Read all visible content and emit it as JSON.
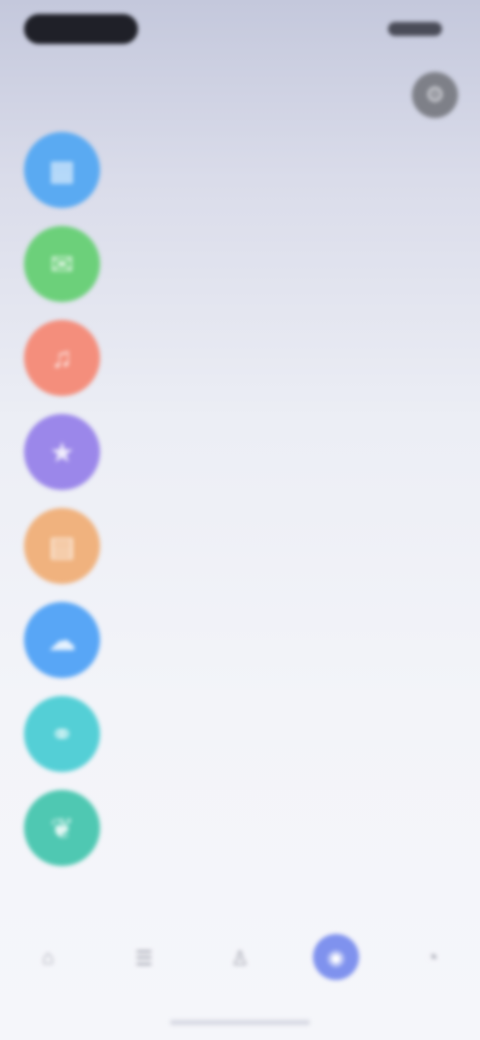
{
  "status_bar": {
    "time": ""
  },
  "header": {
    "title": "",
    "action_icon": "settings-icon"
  },
  "list": [
    {
      "title": "",
      "description": "",
      "color": "#5aaaf2",
      "icon": "grid-icon"
    },
    {
      "title": "",
      "description": "",
      "color": "#6cd07a",
      "icon": "chat-icon"
    },
    {
      "title": "",
      "description": "",
      "color": "#f48e7c",
      "icon": "bell-icon"
    },
    {
      "title": "",
      "description": "",
      "color": "#9b87ea",
      "icon": "star-icon"
    },
    {
      "title": "",
      "description": "",
      "color": "#f0b27e",
      "icon": "folder-icon"
    },
    {
      "title": "",
      "description": "",
      "color": "#58a6f6",
      "icon": "cloud-icon"
    },
    {
      "title": "",
      "description": "",
      "color": "#54cfd6",
      "icon": "link-icon"
    },
    {
      "title": "",
      "description": "",
      "color": "#4fc8b2",
      "icon": "leaf-icon"
    }
  ],
  "bottom_nav": [
    {
      "label": "",
      "icon": "home-icon",
      "active": false
    },
    {
      "label": "",
      "icon": "list-icon",
      "active": false
    },
    {
      "label": "",
      "icon": "user-icon",
      "active": false
    },
    {
      "label": "",
      "icon": "compass-icon",
      "active": true
    },
    {
      "label": "",
      "icon": "profile-icon",
      "active": false
    }
  ]
}
